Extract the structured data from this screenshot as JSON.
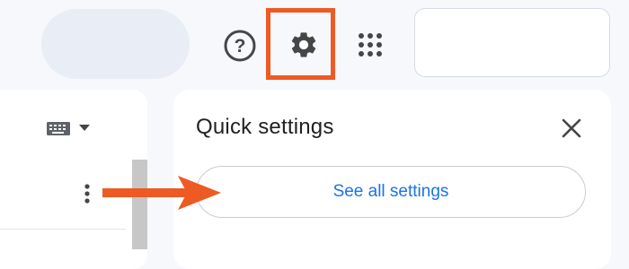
{
  "colors": {
    "background": "#f6f8fc",
    "highlight": "#ee5a24",
    "link_blue": "#1a73e8",
    "icon_gray": "#444746"
  },
  "header": {
    "search_icon": "search-pill",
    "help_icon": "help-circle-icon",
    "settings_icon": "gear-icon",
    "apps_icon": "apps-grid-icon"
  },
  "left_panel": {
    "keyboard_icon": "keyboard-icon",
    "more_icon": "more-vert-icon"
  },
  "quick_settings": {
    "title": "Quick settings",
    "see_all_label": "See all settings",
    "close_icon": "close-icon"
  },
  "annotation": {
    "arrow_icon": "right-arrow-icon"
  }
}
